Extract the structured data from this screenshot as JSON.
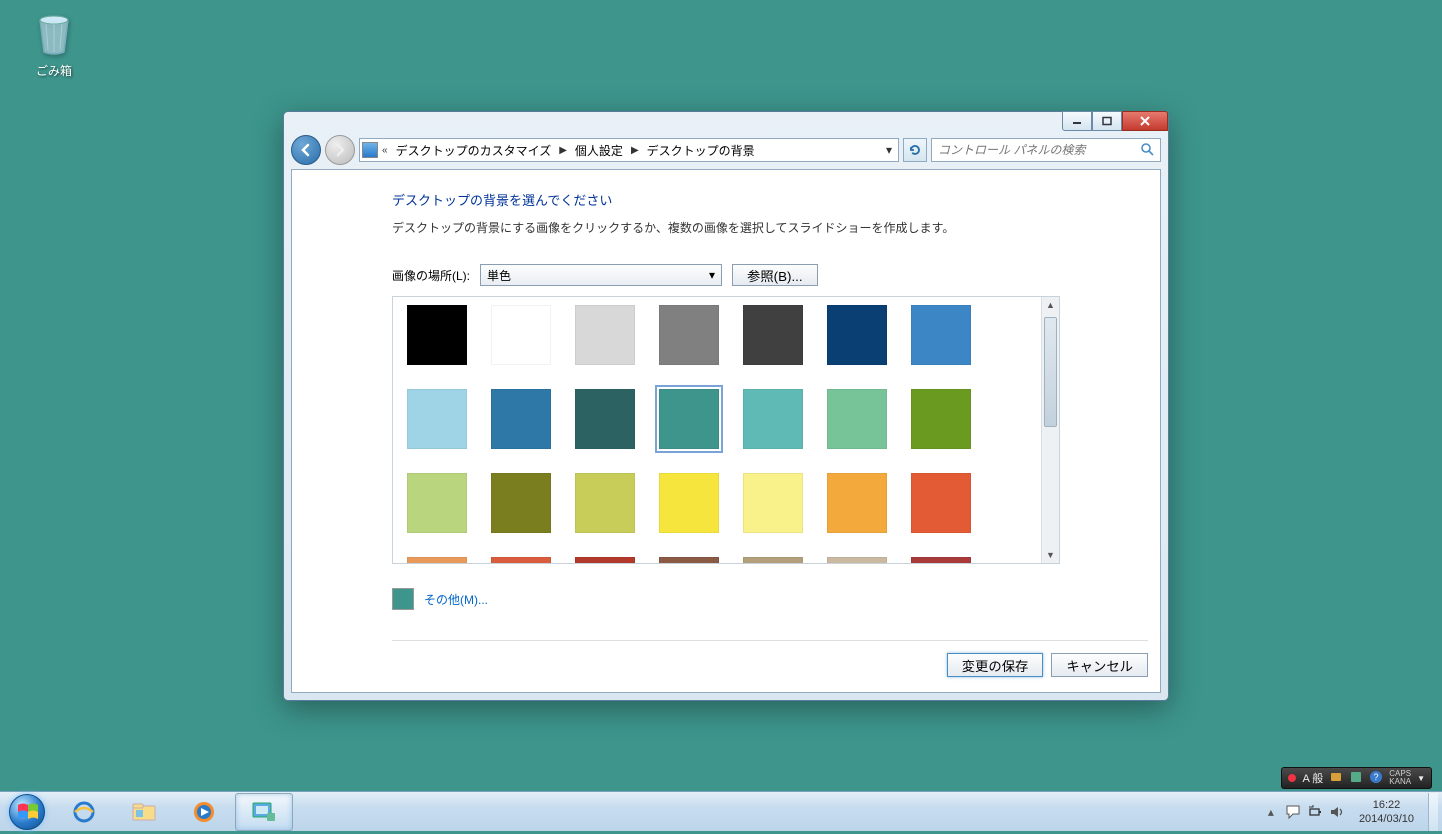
{
  "desktop": {
    "recycle_bin_label": "ごみ箱",
    "background_color": "#3d958c"
  },
  "window": {
    "breadcrumb": {
      "prefix": "«",
      "seg1": "デスクトップのカスタマイズ",
      "seg2": "個人設定",
      "seg3": "デスクトップの背景"
    },
    "search_placeholder": "コントロール パネルの検索",
    "heading": "デスクトップの背景を選んでください",
    "description": "デスクトップの背景にする画像をクリックするか、複数の画像を選択してスライドショーを作成します。",
    "location_label": "画像の場所(L):",
    "location_value": "単色",
    "browse_label": "参照(B)...",
    "other_label": "その他(M)...",
    "save_label": "変更の保存",
    "cancel_label": "キャンセル",
    "selected_index": 10,
    "colors": [
      "#000000",
      "#ffffff",
      "#d8d8d8",
      "#808080",
      "#404040",
      "#0a3f73",
      "#3d86c6",
      "#9fd4e6",
      "#2d78a7",
      "#2d6263",
      "#3d958c",
      "#5fbab5",
      "#78c499",
      "#6a9a1f",
      "#b9d67e",
      "#7a7e1f",
      "#c8cd5a",
      "#f6e53d",
      "#f9f18a",
      "#f3a93c",
      "#e25b34",
      "#e89a5a",
      "#d95c3c",
      "#b23a2a",
      "#8a5a45",
      "#b3a07a",
      "#c8b9a0",
      "#a83a3a"
    ]
  },
  "taskbar": {
    "time": "16:22",
    "date": "2014/03/10"
  },
  "ime": {
    "mode": "A 般",
    "caps": "CAPS",
    "kana": "KANA"
  }
}
